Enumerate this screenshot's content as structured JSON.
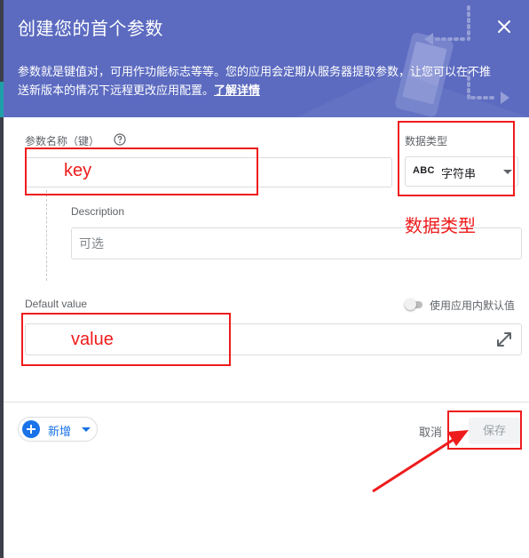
{
  "dialog": {
    "title": "创建您的首个参数",
    "description": "参数就是键值对，可用作功能标志等等。您的应用会定期从服务器提取参数，让您可以在不推送新版本的情况下远程更改应用配置。",
    "learn_more": "了解详情"
  },
  "form": {
    "param_name_label": "参数名称（键）",
    "param_name_value": "",
    "description_label": "Description",
    "description_placeholder": "可选",
    "data_type_label": "数据类型",
    "data_type_icon_text": "ABC",
    "data_type_value": "字符串",
    "default_value_label": "Default value",
    "default_value_value": "",
    "in_app_default_label": "使用应用内默认值",
    "in_app_default_on": false
  },
  "footer": {
    "add_label": "新增",
    "cancel_label": "取消",
    "save_label": "保存"
  },
  "annotations": {
    "key": "key",
    "data_type": "数据类型",
    "value": "value"
  },
  "colors": {
    "header": "#5c6bc0",
    "accent": "#1a73e8",
    "annotation": "#ee1c1c"
  },
  "icons": [
    "close-icon",
    "help-icon",
    "dropdown-icon",
    "expand-icon",
    "add-icon"
  ]
}
